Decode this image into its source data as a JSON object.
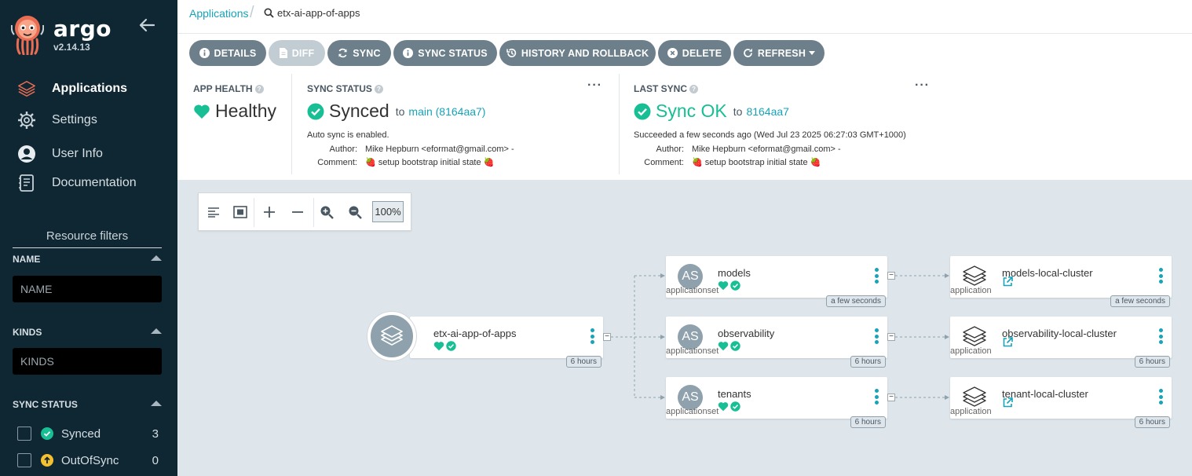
{
  "sidebar": {
    "brand": "argo",
    "version": "v2.14.13",
    "nav": [
      {
        "label": "Applications",
        "icon": "layers-icon"
      },
      {
        "label": "Settings",
        "icon": "gear-icon"
      },
      {
        "label": "User Info",
        "icon": "user-circle-icon"
      },
      {
        "label": "Documentation",
        "icon": "book-icon"
      }
    ],
    "filters_title": "Resource filters",
    "name_filter": {
      "label": "NAME",
      "placeholder": "NAME"
    },
    "kinds_filter": {
      "label": "KINDS",
      "placeholder": "KINDS"
    },
    "sync_status": {
      "label": "SYNC STATUS",
      "options": [
        {
          "label": "Synced",
          "count": "3",
          "color": "#18be94"
        },
        {
          "label": "OutOfSync",
          "count": "0",
          "color": "#f4c030"
        }
      ]
    }
  },
  "breadcrumb": {
    "root": "Applications",
    "current": "etx-ai-app-of-apps"
  },
  "toolbar": {
    "details": "DETAILS",
    "diff": "DIFF",
    "sync": "SYNC",
    "sync_status": "SYNC STATUS",
    "history": "HISTORY AND ROLLBACK",
    "delete": "DELETE",
    "refresh": "REFRESH"
  },
  "app_health": {
    "label": "APP HEALTH",
    "value": "Healthy"
  },
  "sync_panel": {
    "label": "SYNC STATUS",
    "value": "Synced",
    "to": "to",
    "revision": "main (8164aa7)",
    "auto_sync": "Auto sync is enabled.",
    "author_key": "Author:",
    "author": "Mike Hepburn <eformat@gmail.com> -",
    "comment_key": "Comment:",
    "comment": "🍓 setup bootstrap initial state 🍓"
  },
  "last_sync": {
    "label": "LAST SYNC",
    "value": "Sync OK",
    "to": "to",
    "revision": "8164aa7",
    "succeeded": "Succeeded a few seconds ago (Wed Jul 23 2025 06:27:03 GMT+1000)",
    "author_key": "Author:",
    "author": "Mike Hepburn <eformat@gmail.com> -",
    "comment_key": "Comment:",
    "comment": "🍓 setup bootstrap initial state 🍓"
  },
  "zoom": {
    "level": "100%"
  },
  "graph": {
    "root": {
      "name": "etx-ai-app-of-apps",
      "age": "6 hours"
    },
    "appsets": [
      {
        "name": "models",
        "kind": "applicationset",
        "abbr": "AS",
        "age": "a few seconds"
      },
      {
        "name": "observability",
        "kind": "applicationset",
        "abbr": "AS",
        "age": "6 hours"
      },
      {
        "name": "tenants",
        "kind": "applicationset",
        "abbr": "AS",
        "age": "6 hours"
      }
    ],
    "apps": [
      {
        "name": "models-local-cluster",
        "kind": "application",
        "age": "a few seconds"
      },
      {
        "name": "observability-local-cluster",
        "kind": "application",
        "age": "6 hours"
      },
      {
        "name": "tenant-local-cluster",
        "kind": "application",
        "age": "6 hours"
      }
    ]
  },
  "colors": {
    "accent": "#17a3b8",
    "healthy": "#18be94",
    "sidebar": "#0f2733",
    "button": "#6d7f8b"
  }
}
